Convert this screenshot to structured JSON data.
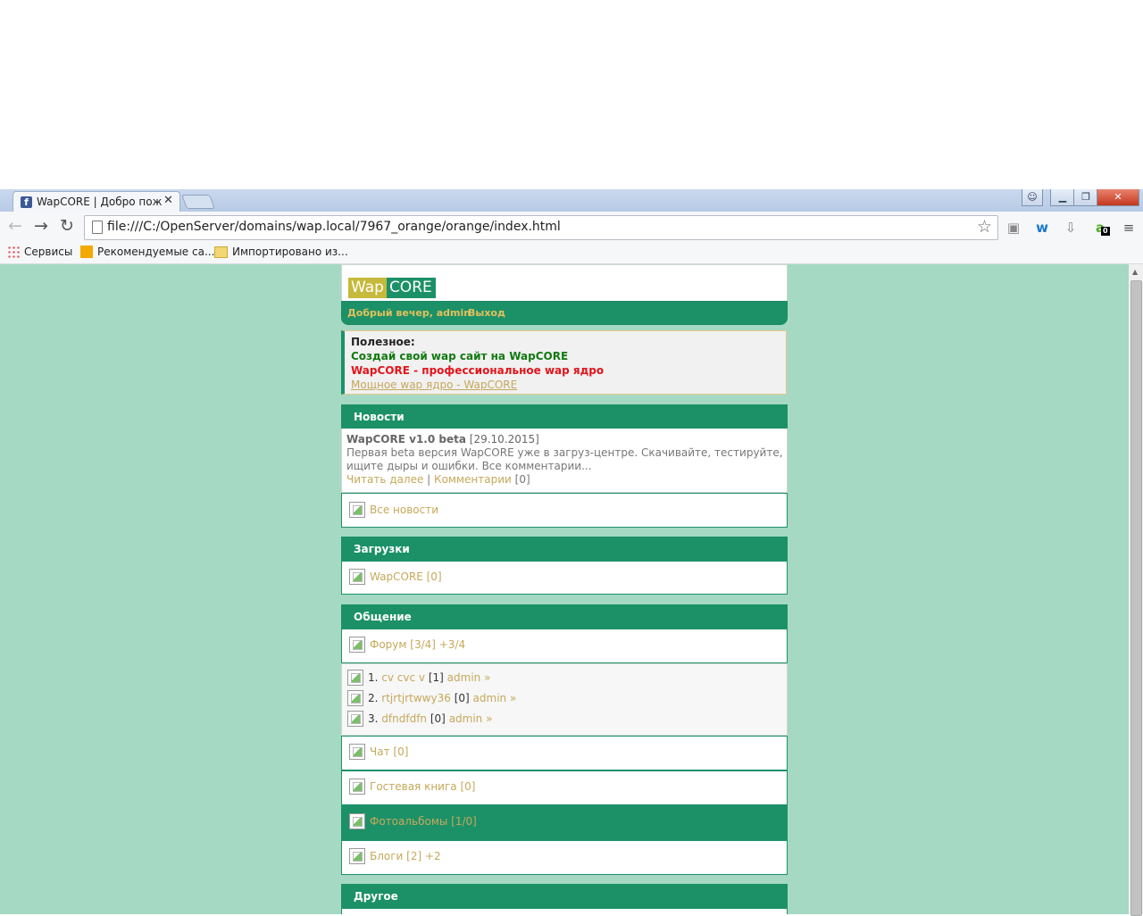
{
  "browser": {
    "tab_title": "WapCORE | Добро пожал",
    "tab_close": "✕",
    "url": "file:///C:/OpenServer/domains/wap.local/7967_orange/orange/index.html",
    "bookmarks": [
      "Сервисы",
      "Рекомендуемые са...",
      "Импортировано из..."
    ],
    "extension_badge": "0"
  },
  "site": {
    "logo_wap": "Wap",
    "logo_core": "CORE",
    "greeting": "Добрый вечер, admin",
    "logout": "Выход"
  },
  "notice": {
    "title": "Полезное:",
    "line1": "Создай свой wap сайт на WapCORE",
    "line2": "WapCORE - профессиональное wap ядро",
    "link": "Мощное wap ядро - WapCORE",
    "colors": {
      "line1": "#127a12",
      "line2": "#e3141b",
      "link": "#c6a85a"
    }
  },
  "news": {
    "header": "Новости",
    "item_title": "WapCORE v1.0 beta",
    "item_date": "[29.10.2015]",
    "item_text_1": "Первая beta версия WapCORE уже в загруз-центре. Скачивайте, тестируйте,",
    "item_text_2": "ищите дыры и ошибки. Все комментарии...",
    "read_more": "Читать далее",
    "separator": "|",
    "comments": "Комментарии",
    "comments_count": "[0]",
    "all_news": "Все новости"
  },
  "downloads": {
    "header": "Загрузки",
    "item": "WapCORE [0]"
  },
  "community": {
    "header": "Общение",
    "forum": "Форум [3/4] +3/4",
    "topics": [
      {
        "num": "1.",
        "title": "cv cvc v",
        "count": "[1]",
        "author": "admin »"
      },
      {
        "num": "2.",
        "title": "rtjrtjrtwwy36",
        "count": "[0]",
        "author": "admin »"
      },
      {
        "num": "3.",
        "title": "dfndfdfn",
        "count": "[0]",
        "author": "admin »"
      }
    ],
    "chat": "Чат [0]",
    "guestbook": "Гостевая книга [0]",
    "photoalbums": "Фотоальбомы [1/0]",
    "blogs": "Блоги [2] +2"
  },
  "other": {
    "header": "Другое"
  },
  "colors": {
    "page_bg": "#a5d9c3",
    "accent": "#1c9168",
    "link": "#c6a85a"
  }
}
